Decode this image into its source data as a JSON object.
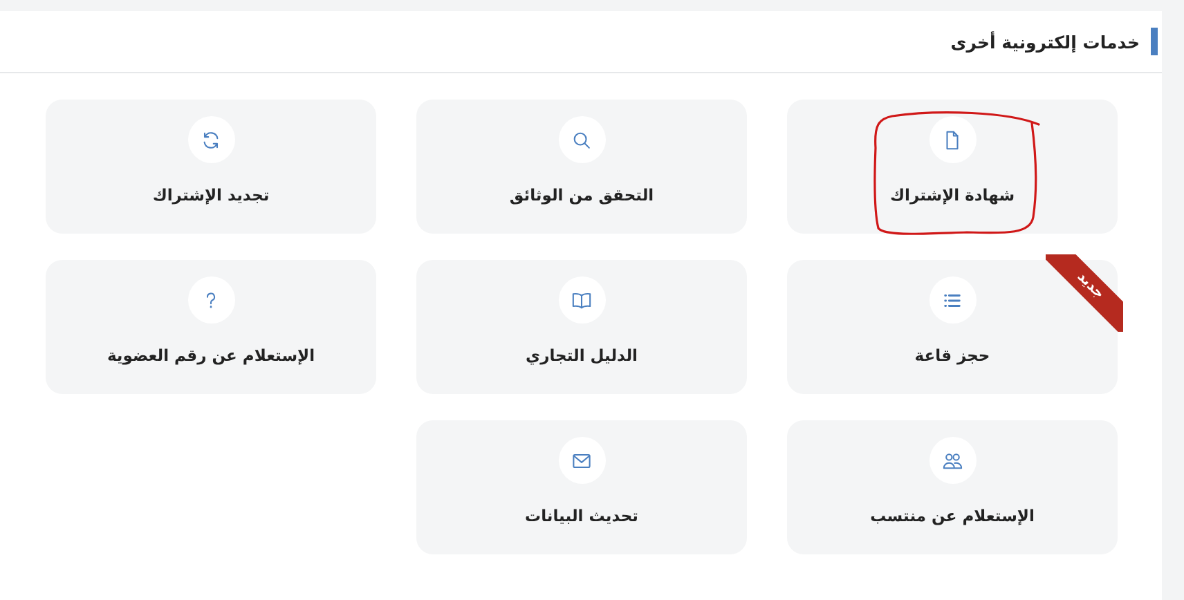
{
  "section": {
    "title": "خدمات إلكترونية أخرى"
  },
  "cards": [
    {
      "label": "شهادة الإشتراك",
      "highlighted": true
    },
    {
      "label": "التحقق من الوثائق",
      "highlighted": false
    },
    {
      "label": "تجديد الإشتراك",
      "highlighted": false
    },
    {
      "label": "حجز قاعة",
      "highlighted": false,
      "badge": "جديد"
    },
    {
      "label": "الدليل التجاري",
      "highlighted": false
    },
    {
      "label": "الإستعلام عن رقم العضوية",
      "highlighted": false
    },
    {
      "label": "الإستعلام عن منتسب",
      "highlighted": false
    },
    {
      "label": "تحديث البيانات",
      "highlighted": false
    }
  ]
}
